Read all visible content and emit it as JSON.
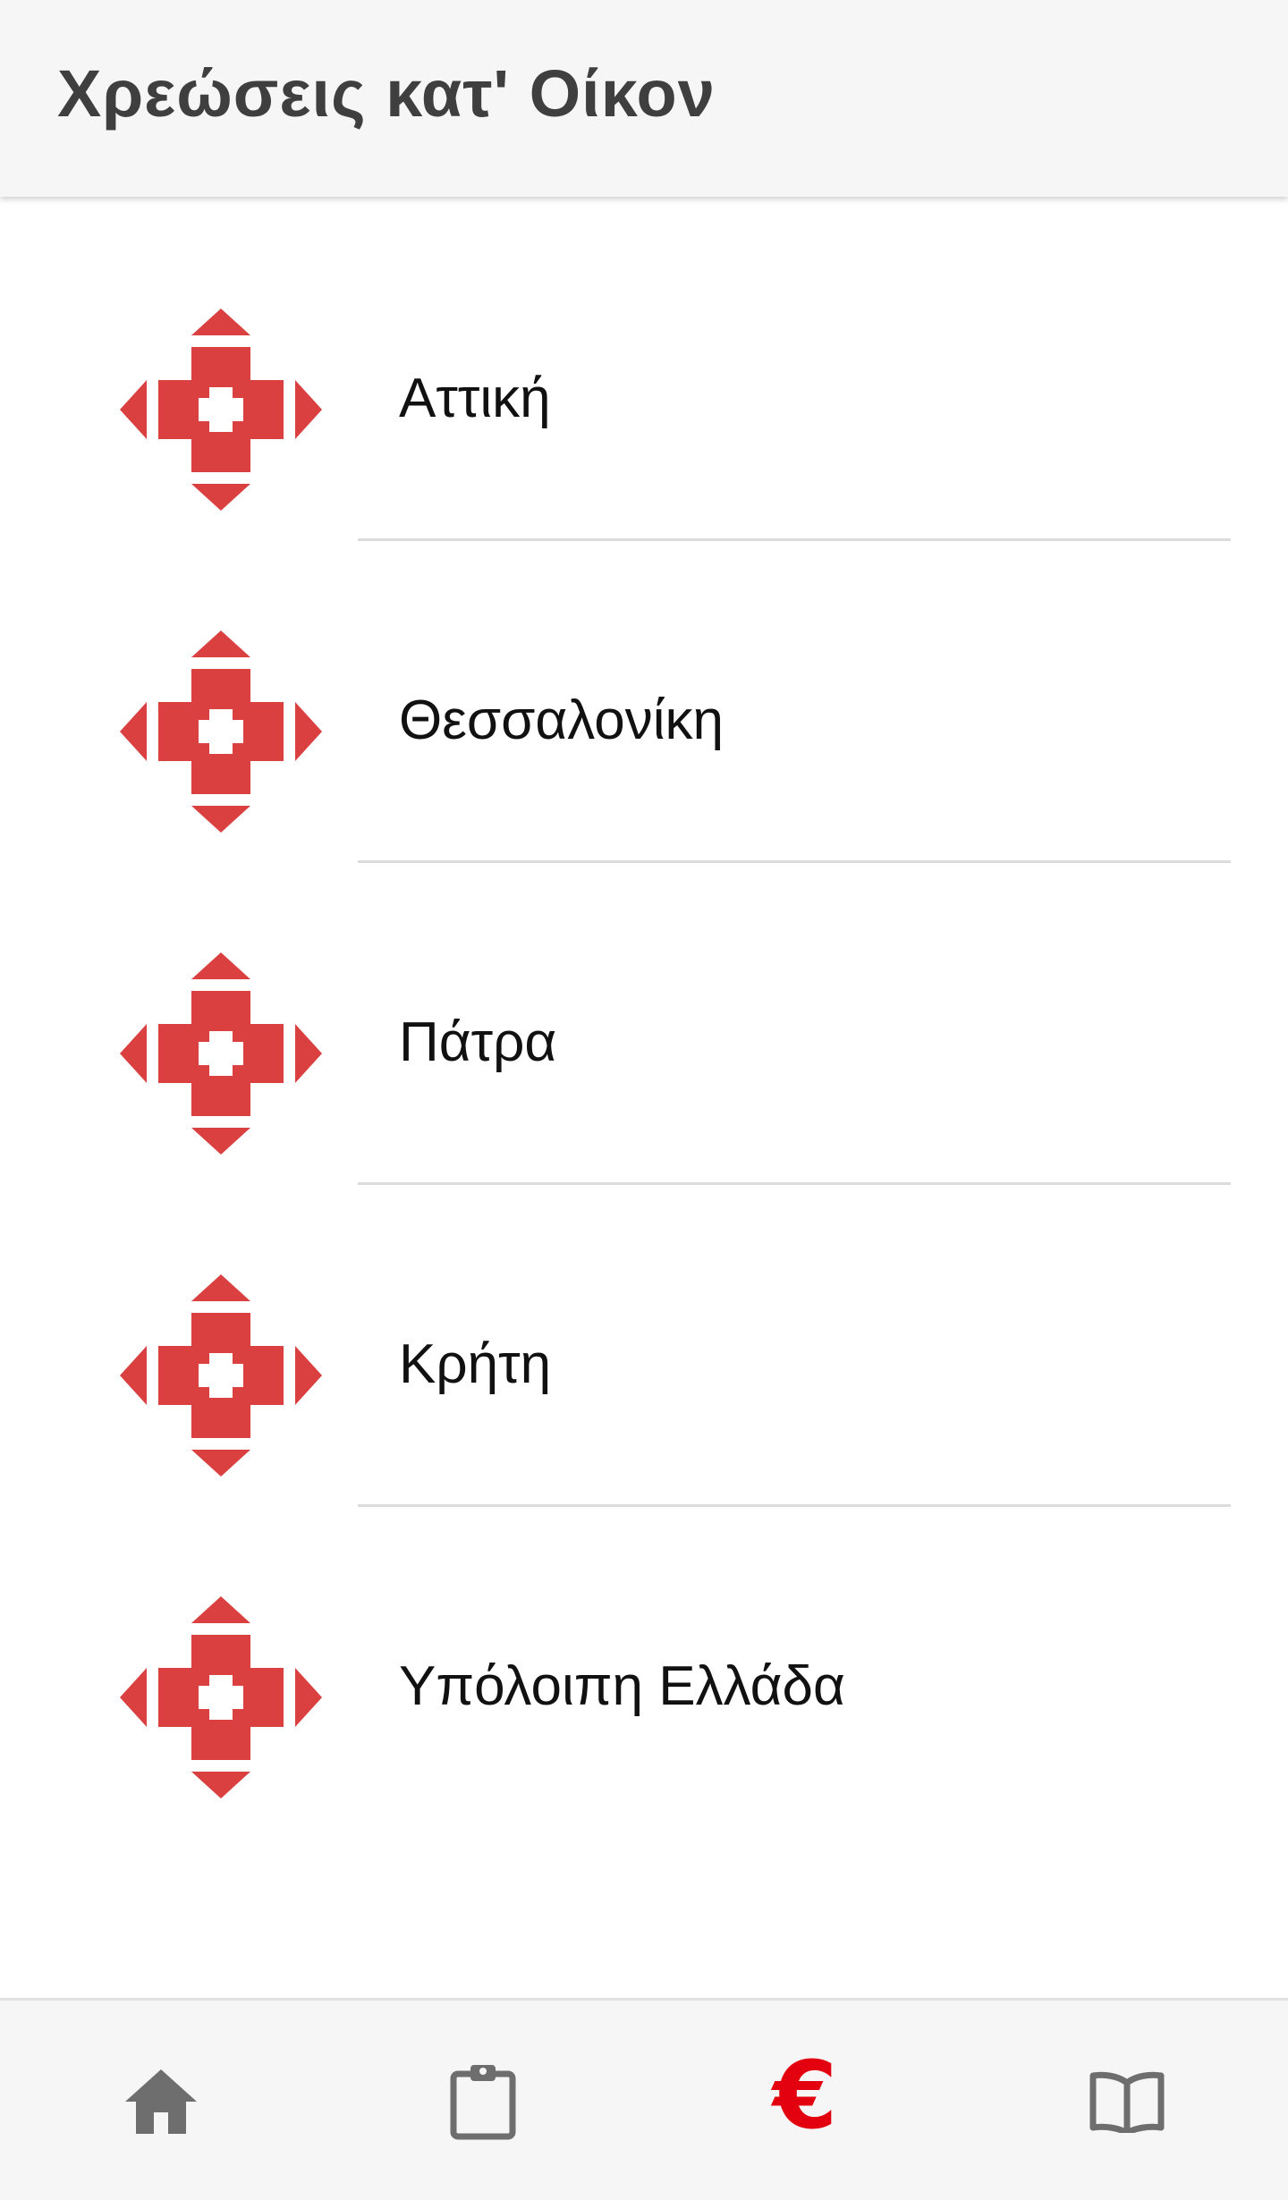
{
  "app_bar": {
    "title": "Χρεώσεις κατ' Οίκον"
  },
  "regions": [
    {
      "label": "Αττική",
      "icon": "red-cross-logo-icon"
    },
    {
      "label": "Θεσσαλονίκη",
      "icon": "red-cross-logo-icon"
    },
    {
      "label": "Πάτρα",
      "icon": "red-cross-logo-icon"
    },
    {
      "label": "Κρήτη",
      "icon": "red-cross-logo-icon"
    },
    {
      "label": "Υπόλοιπη Ελλάδα",
      "icon": "red-cross-logo-icon"
    }
  ],
  "bottom_nav": {
    "items": [
      {
        "icon": "home-icon",
        "active": false
      },
      {
        "icon": "clipboard-icon",
        "active": false
      },
      {
        "icon": "euro-icon",
        "glyph": "€",
        "active": true
      },
      {
        "icon": "book-icon",
        "active": false
      }
    ]
  },
  "colors": {
    "logo_red": "#d9403f",
    "accent_red": "#e3000f",
    "nav_icon_grey": "#6e6e6e",
    "title_text": "#3f3f3f",
    "bar_background": "#f6f6f6"
  }
}
